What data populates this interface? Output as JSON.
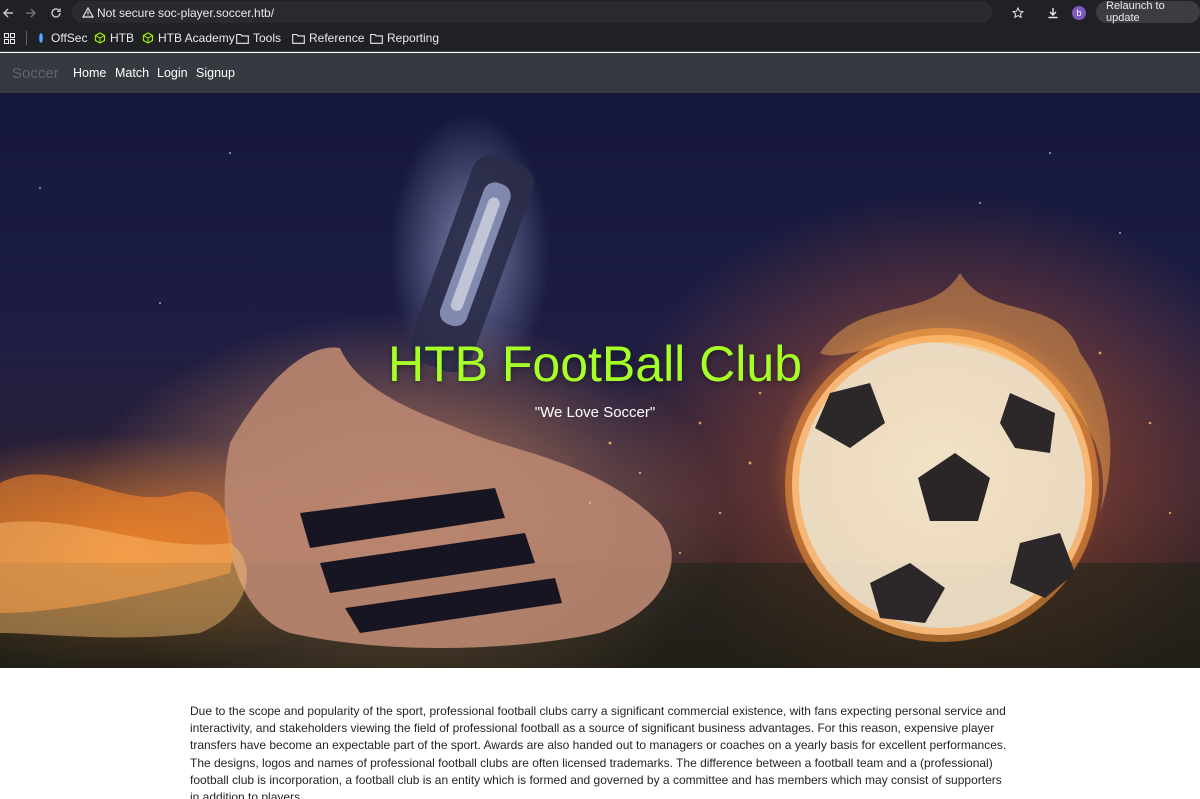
{
  "browser": {
    "security_label": "Not secure",
    "url": "soc-player.soccer.htb/",
    "avatar_letter": "b",
    "relaunch_label": "Relaunch to update",
    "icons": [
      "back-icon",
      "forward-icon",
      "reload-icon",
      "warning-icon",
      "star-icon",
      "download-icon"
    ]
  },
  "bookmarks": {
    "items": [
      {
        "label": "OffSec",
        "icon": "offsec-icon"
      },
      {
        "label": "HTB",
        "icon": "htb-cube-icon"
      },
      {
        "label": "HTB Academy",
        "icon": "htb-cube-icon"
      },
      {
        "label": "Tools",
        "icon": "folder-icon"
      },
      {
        "label": "Reference",
        "icon": "folder-icon"
      },
      {
        "label": "Reporting",
        "icon": "folder-icon"
      }
    ]
  },
  "site_nav": {
    "brand": "Soccer",
    "links": [
      "Home",
      "Match",
      "Login",
      "Signup"
    ]
  },
  "hero": {
    "title": "HTB FootBall Club",
    "subtitle": "\"We Love Soccer\""
  },
  "content": {
    "paragraph": "Due to the scope and popularity of the sport, professional football clubs carry a significant commercial existence, with fans expecting personal service and interactivity, and stakeholders viewing the field of professional football as a source of significant business advantages. For this reason, expensive player transfers have become an expectable part of the sport. Awards are also handed out to managers or coaches on a yearly basis for excellent performances. The designs, logos and names of professional football clubs are often licensed trademarks. The difference between a football team and a (professional) football club is incorporation, a football club is an entity which is formed and governed by a committee and has members which may consist of supporters in addition to players."
  },
  "colors": {
    "chrome_bg": "#202124",
    "navbar_bg": "#343a40",
    "hero_title": "#a6ff27",
    "text": "#212529"
  }
}
